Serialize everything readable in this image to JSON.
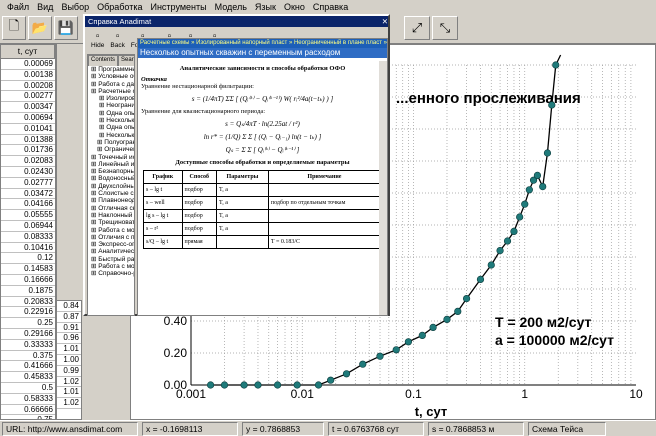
{
  "menu": [
    "Файл",
    "Вид",
    "Выбор",
    "Обработка",
    "Инструменты",
    "Модель",
    "Язык",
    "Окно",
    "Справка"
  ],
  "table": {
    "headers": [
      "t, сут"
    ],
    "rows": [
      "0.00069",
      "0.00138",
      "0.00208",
      "0.00277",
      "0.00347",
      "0.00694",
      "0.01041",
      "0.01388",
      "0.01736",
      "0.02083",
      "0.02430",
      "0.02777",
      "0.03472",
      "0.04166",
      "0.05555",
      "0.06944",
      "0.08333",
      "0.10416",
      "0.12",
      "0.14583",
      "0.16666",
      "0.1875",
      "0.20833",
      "0.22916",
      "0.25",
      "0.29166",
      "0.33333",
      "0.375",
      "0.41666",
      "0.45833",
      "0.5",
      "0.58333",
      "0.66666",
      "0.75"
    ],
    "col2": [
      "0.84",
      "0.87",
      "0.91",
      "0.96",
      "1.01",
      "1.00",
      "0.99",
      "1.02",
      "1.01",
      "1.02"
    ]
  },
  "help": {
    "title": "Справка Anadimat",
    "tools": [
      "Hide",
      "Back",
      "Forward",
      "Home",
      "Print",
      "Options"
    ],
    "tabs": [
      "Contents",
      "Search",
      "Favorites"
    ],
    "tree": [
      "Программный комплекс",
      "Условные обозначения",
      "Работа с данными",
      "Расчетные схемы",
      "Изолированные",
      "Неограниченные",
      "Одна опытная",
      "Несколько оп",
      "Одна опытная",
      "Несколько оп",
      "Полуограниченные",
      "Ограниченный",
      "Точечный источник",
      "Линейный источник",
      "Безнапорный пласт",
      "Водоносный комплекс",
      "Двухслойный водоносный",
      "Слоистые системы",
      "Плавнонеоднородный",
      "Отличная скорость",
      "Наклонный пласт",
      "Трещиноватый",
      "Работа с моделями",
      "Отличия с постоянным",
      "Экспресс-опробования",
      "Аналитическое моделирование",
      "Быстрый расчет",
      "Работа с моделями",
      "Справочно-расчетные"
    ],
    "crumb": "Расчетные схемы » Изолированный напорный пласт » Неограниченный в плане пласт »",
    "heading": "Несколько опытных скважин с переменным расходом",
    "sub": "Аналитические зависимости и способы обработки ОФО",
    "section": "Откачка",
    "eq1_label": "Уравнение нестационарной фильтрации:",
    "eq2_label": "Уравнение для квазистационарного периода:",
    "table_title": "Доступные способы обработки и определяемые параметры",
    "table_headers": [
      "График",
      "Способ",
      "Параметры",
      "Примечание"
    ],
    "table_rows": [
      [
        "s – lg t",
        "подбор",
        "T, a",
        ""
      ],
      [
        "s – well",
        "подбор",
        "T, a",
        "подбор по отдельным точкам"
      ],
      [
        "lg s – lg t",
        "подбор",
        "T, a",
        ""
      ],
      [
        "s – r²",
        "подбор",
        "T, a",
        ""
      ],
      [
        "s/Q – lg t",
        "прямая",
        "",
        "T = 0.183/C"
      ]
    ]
  },
  "chart_data": {
    "type": "line",
    "title": "...енного прослеживания",
    "xlabel": "t, сут",
    "xscale": "log",
    "xlim": [
      0.001,
      10
    ],
    "ylim": [
      0,
      2
    ],
    "xticks": [
      "0.001",
      "0.01",
      "0.1",
      "1",
      "10"
    ],
    "yticks": [
      "0.00",
      "0.20",
      "0.40"
    ],
    "annotation": [
      "T = 200 м2/сут",
      "a = 100000 м2/сут"
    ],
    "series": [
      {
        "x": [
          0.0015,
          0.002,
          0.003,
          0.004,
          0.006,
          0.009,
          0.014,
          0.018,
          0.025,
          0.035,
          0.05,
          0.07,
          0.09,
          0.12,
          0.15,
          0.2,
          0.25,
          0.3,
          0.4,
          0.5,
          0.6,
          0.7,
          0.8,
          0.9,
          1.0,
          1.1,
          1.2,
          1.3,
          1.45,
          1.6,
          1.75,
          1.9
        ],
        "y": [
          0.0,
          0.0,
          0.0,
          0.0,
          0.0,
          0.0,
          0.0,
          0.03,
          0.07,
          0.13,
          0.18,
          0.22,
          0.27,
          0.31,
          0.36,
          0.41,
          0.46,
          0.54,
          0.66,
          0.75,
          0.84,
          0.9,
          0.96,
          1.05,
          1.13,
          1.22,
          1.28,
          1.31,
          1.24,
          1.45,
          1.75,
          2.0
        ]
      }
    ]
  },
  "status": [
    "URL: http://www.ansdimat.com",
    "x = -0.1698113",
    "y = 0.7868853",
    "t = 0.6763768 сут",
    "s = 0.7868853 м",
    "Схема Тейса"
  ]
}
